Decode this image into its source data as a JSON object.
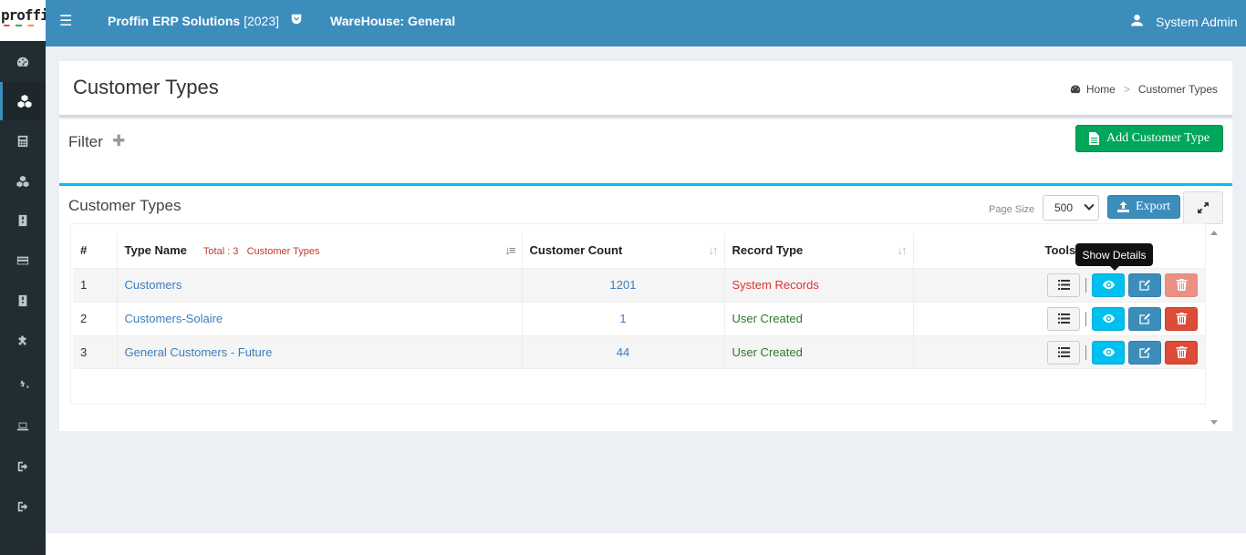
{
  "logo": {
    "text": "proffin"
  },
  "sidebar": {
    "items": [
      {
        "icon": "dashboard-icon",
        "active": false
      },
      {
        "icon": "cubes-icon",
        "active": true
      },
      {
        "icon": "calculator-icon",
        "active": false
      },
      {
        "icon": "cubes-icon",
        "active": false
      },
      {
        "icon": "book-icon",
        "active": false
      },
      {
        "icon": "credit-card-icon",
        "active": false
      },
      {
        "icon": "book-icon",
        "active": false
      },
      {
        "icon": "puzzle-icon",
        "active": false
      },
      {
        "icon": "cogs-icon",
        "active": false
      },
      {
        "icon": "laptop-icon",
        "active": false
      },
      {
        "icon": "sign-out-icon",
        "active": false
      },
      {
        "icon": "sign-out-icon",
        "active": false
      }
    ]
  },
  "header": {
    "app_name": "Proffin ERP Solutions",
    "year": "[2023]",
    "warehouse": "WareHouse: General",
    "user": "System Admin"
  },
  "page": {
    "title": "Customer Types",
    "breadcrumb": {
      "home": "Home",
      "sep": ">",
      "current": "Customer Types"
    }
  },
  "filter": {
    "title": "Filter",
    "plus": "✚",
    "add_button": "Add Customer Type"
  },
  "list": {
    "title": "Customer Types",
    "page_size_label": "Page Size",
    "page_size_value": "500",
    "export_label": "Export",
    "columns": {
      "index": "#",
      "type_name": "Type Name",
      "total_label": "Total : 3",
      "total_suffix": "Customer Types",
      "customer_count": "Customer Count",
      "record_type": "Record Type",
      "tools": "Tools"
    },
    "rows": [
      {
        "index": "1",
        "name": "Customers",
        "count": "1201",
        "record_type": "System Records",
        "system": true
      },
      {
        "index": "2",
        "name": "Customers-Solaire",
        "count": "1",
        "record_type": "User Created",
        "system": false
      },
      {
        "index": "3",
        "name": "General Customers - Future",
        "count": "44",
        "record_type": "User Created",
        "system": false
      }
    ]
  },
  "tooltip": {
    "text": "Show Details"
  },
  "colors": {
    "header": "#3c8dbc",
    "sidebar": "#222d32",
    "success": "#00a65a",
    "info": "#00c0ef",
    "danger": "#dd4b39"
  }
}
